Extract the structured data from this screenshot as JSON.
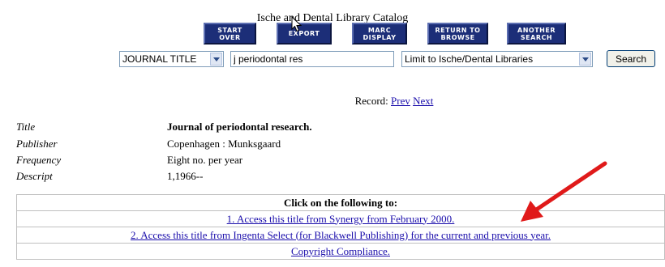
{
  "header": {
    "catalog_title": "Ische and Dental Library Catalog"
  },
  "nav_buttons": [
    {
      "label": "START\nOVER"
    },
    {
      "label": "EXPORT"
    },
    {
      "label": "MARC\nDISPLAY"
    },
    {
      "label": "RETURN TO\nBROWSE"
    },
    {
      "label": "ANOTHER\nSEARCH"
    }
  ],
  "search": {
    "index_selected": "JOURNAL TITLE",
    "query": "j periodontal res",
    "scope_selected": "Limit to Ische/Dental Libraries",
    "button_label": "Search"
  },
  "record_nav": {
    "label": "Record:",
    "prev": "Prev",
    "next": "Next"
  },
  "record": {
    "fields": [
      {
        "label": "Title",
        "value": "Journal of periodontal research."
      },
      {
        "label": "Publisher",
        "value": "Copenhagen : Munksgaard"
      },
      {
        "label": "Frequency",
        "value": "Eight no. per year"
      },
      {
        "label": "Descript",
        "value": "1,1966--"
      }
    ]
  },
  "links": {
    "header": "Click on the following to:",
    "items": [
      "1. Access this title from Synergy from February 2000.",
      "2. Access this title from Ingenta Select (for Blackwell Publishing) for the current and previous year.",
      "Copyright Compliance."
    ]
  },
  "colors": {
    "nav_button_bg": "#1c2e78",
    "link": "#1a0dab",
    "annotation_arrow": "#e01a1a"
  }
}
